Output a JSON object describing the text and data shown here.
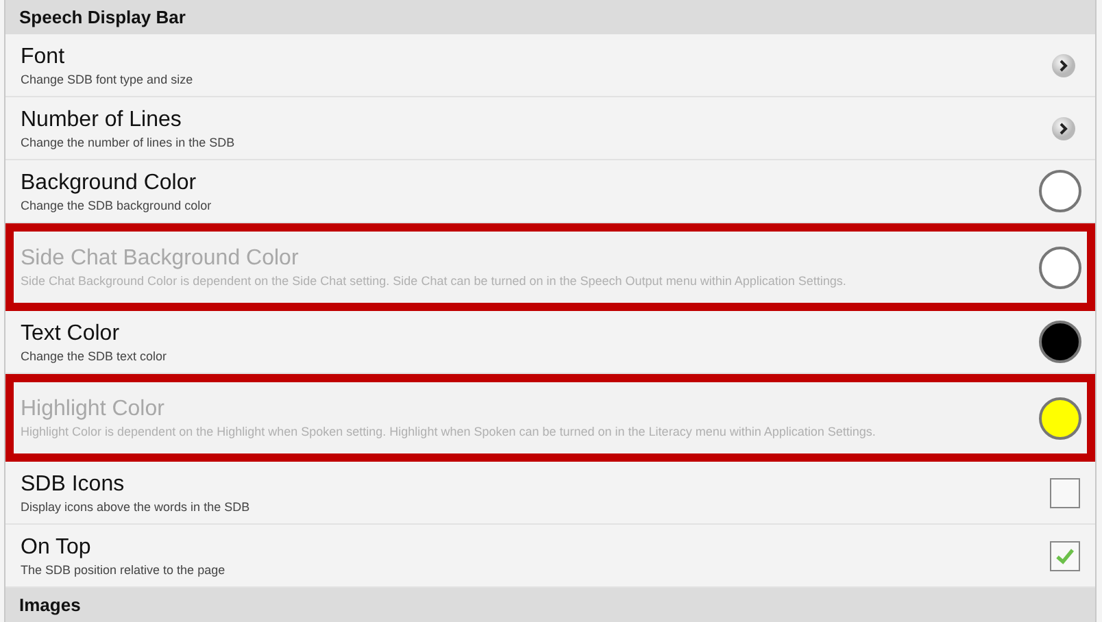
{
  "section": {
    "title": "Speech Display Bar"
  },
  "rows": [
    {
      "kind": "nav",
      "title": "Font",
      "subtitle": "Change SDB font type and size",
      "disabled": false,
      "highlighted": false
    },
    {
      "kind": "nav",
      "title": "Number of Lines",
      "subtitle": "Change the number of lines in the SDB",
      "disabled": false,
      "highlighted": false
    },
    {
      "kind": "color",
      "title": "Background Color",
      "subtitle": "Change the SDB background color",
      "disabled": false,
      "highlighted": false,
      "color": "#ffffff"
    },
    {
      "kind": "color",
      "title": "Side Chat Background Color",
      "subtitle": "Side Chat Background Color is dependent on the Side Chat setting. Side Chat can be turned on in the Speech Output menu within Application Settings.",
      "disabled": true,
      "highlighted": true,
      "color": "#ffffff"
    },
    {
      "kind": "color",
      "title": "Text Color",
      "subtitle": "Change the SDB text color",
      "disabled": false,
      "highlighted": false,
      "color": "#000000"
    },
    {
      "kind": "color",
      "title": "Highlight Color",
      "subtitle": "Highlight Color is dependent on the Highlight when Spoken setting. Highlight when Spoken can be turned on in the Literacy menu within Application Settings.",
      "disabled": true,
      "highlighted": true,
      "color": "#ffff00"
    },
    {
      "kind": "checkbox",
      "title": "SDB Icons",
      "subtitle": "Display icons above the words in the SDB",
      "disabled": false,
      "highlighted": false,
      "checked": false
    },
    {
      "kind": "checkbox",
      "title": "On Top",
      "subtitle": "The SDB position relative to the page",
      "disabled": false,
      "highlighted": false,
      "checked": true
    }
  ],
  "next_section": {
    "title": "Images"
  }
}
